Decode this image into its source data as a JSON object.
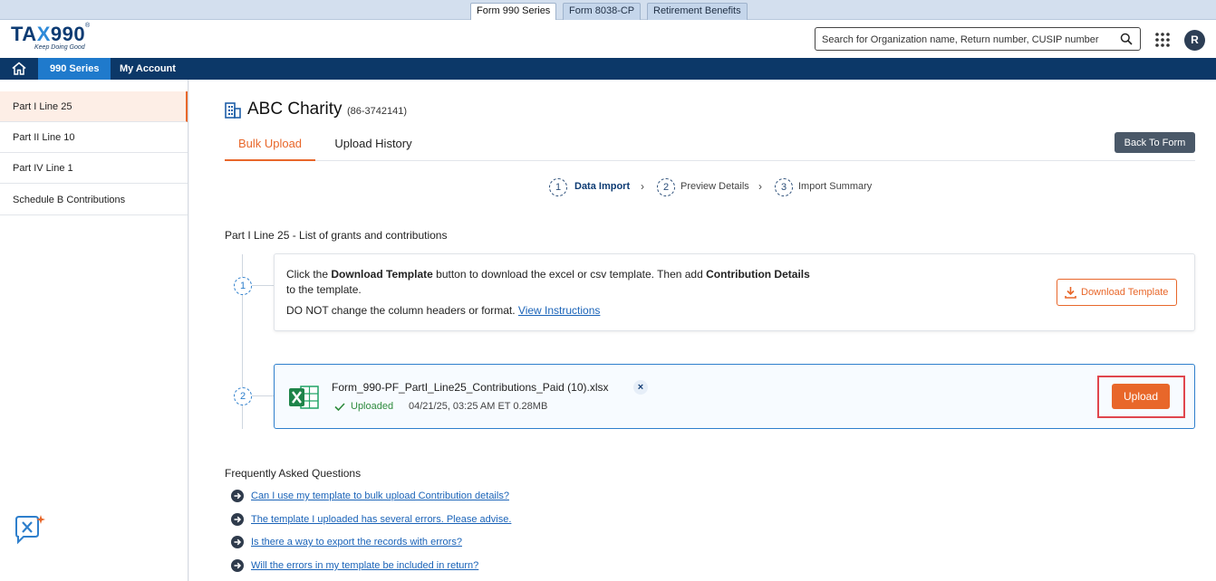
{
  "product_tabs": [
    {
      "label": "Form 990 Series",
      "active": true
    },
    {
      "label": "Form 8038-CP",
      "active": false
    },
    {
      "label": "Retirement Benefits",
      "active": false
    }
  ],
  "header": {
    "logo_main": "TA",
    "logo_x": "X",
    "logo_end": "990",
    "logo_reg": "®",
    "logo_tagline": "Keep Doing Good",
    "search_placeholder": "Search for Organization name, Return number, CUSIP number",
    "avatar_initial": "R"
  },
  "nav": {
    "items": [
      "990 Series",
      "My Account"
    ]
  },
  "sidebar": {
    "items": [
      {
        "label": "Part I Line 25",
        "active": true
      },
      {
        "label": "Part II Line 10",
        "active": false
      },
      {
        "label": "Part IV Line 1",
        "active": false
      },
      {
        "label": "Schedule B Contributions",
        "active": false
      }
    ]
  },
  "org": {
    "name": "ABC Charity",
    "ein": "(86-3742141)"
  },
  "tabs": {
    "bulk_upload": "Bulk Upload",
    "upload_history": "Upload History",
    "back_button": "Back To Form"
  },
  "steps": [
    {
      "num": "1",
      "label": "Data Import",
      "current": true
    },
    {
      "num": "2",
      "label": "Preview Details",
      "current": false
    },
    {
      "num": "3",
      "label": "Import Summary",
      "current": false
    }
  ],
  "section_title": "Part I Line 25 - List of grants and contributions",
  "step1": {
    "num": "1",
    "text_a": "Click the ",
    "bold_a": "Download Template",
    "text_b": " button to download the excel or csv template. Then add ",
    "bold_b": "Contribution Details",
    "text_c": " to the template.",
    "warning": "DO NOT change the column headers or format. ",
    "link": "View Instructions",
    "download_button": "Download Template"
  },
  "step2": {
    "num": "2",
    "filename": "Form_990-PF_PartI_Line25_Contributions_Paid (10).xlsx",
    "status": "Uploaded",
    "meta": "04/21/25, 03:25 AM ET 0.28MB",
    "upload_button": "Upload",
    "remove": "×"
  },
  "faq": {
    "title": "Frequently Asked Questions",
    "questions": [
      "Can I use my template to bulk upload Contribution details?",
      "The template I uploaded has several errors. Please advise.",
      "Is there a way to export the records with errors?",
      "Will the errors in my template be included in return?"
    ]
  },
  "colors": {
    "accent": "#e8672a",
    "nav_bg": "#0c3868",
    "nav_active": "#1f7acc",
    "link": "#1a63b8",
    "success": "#2e8b3d"
  }
}
